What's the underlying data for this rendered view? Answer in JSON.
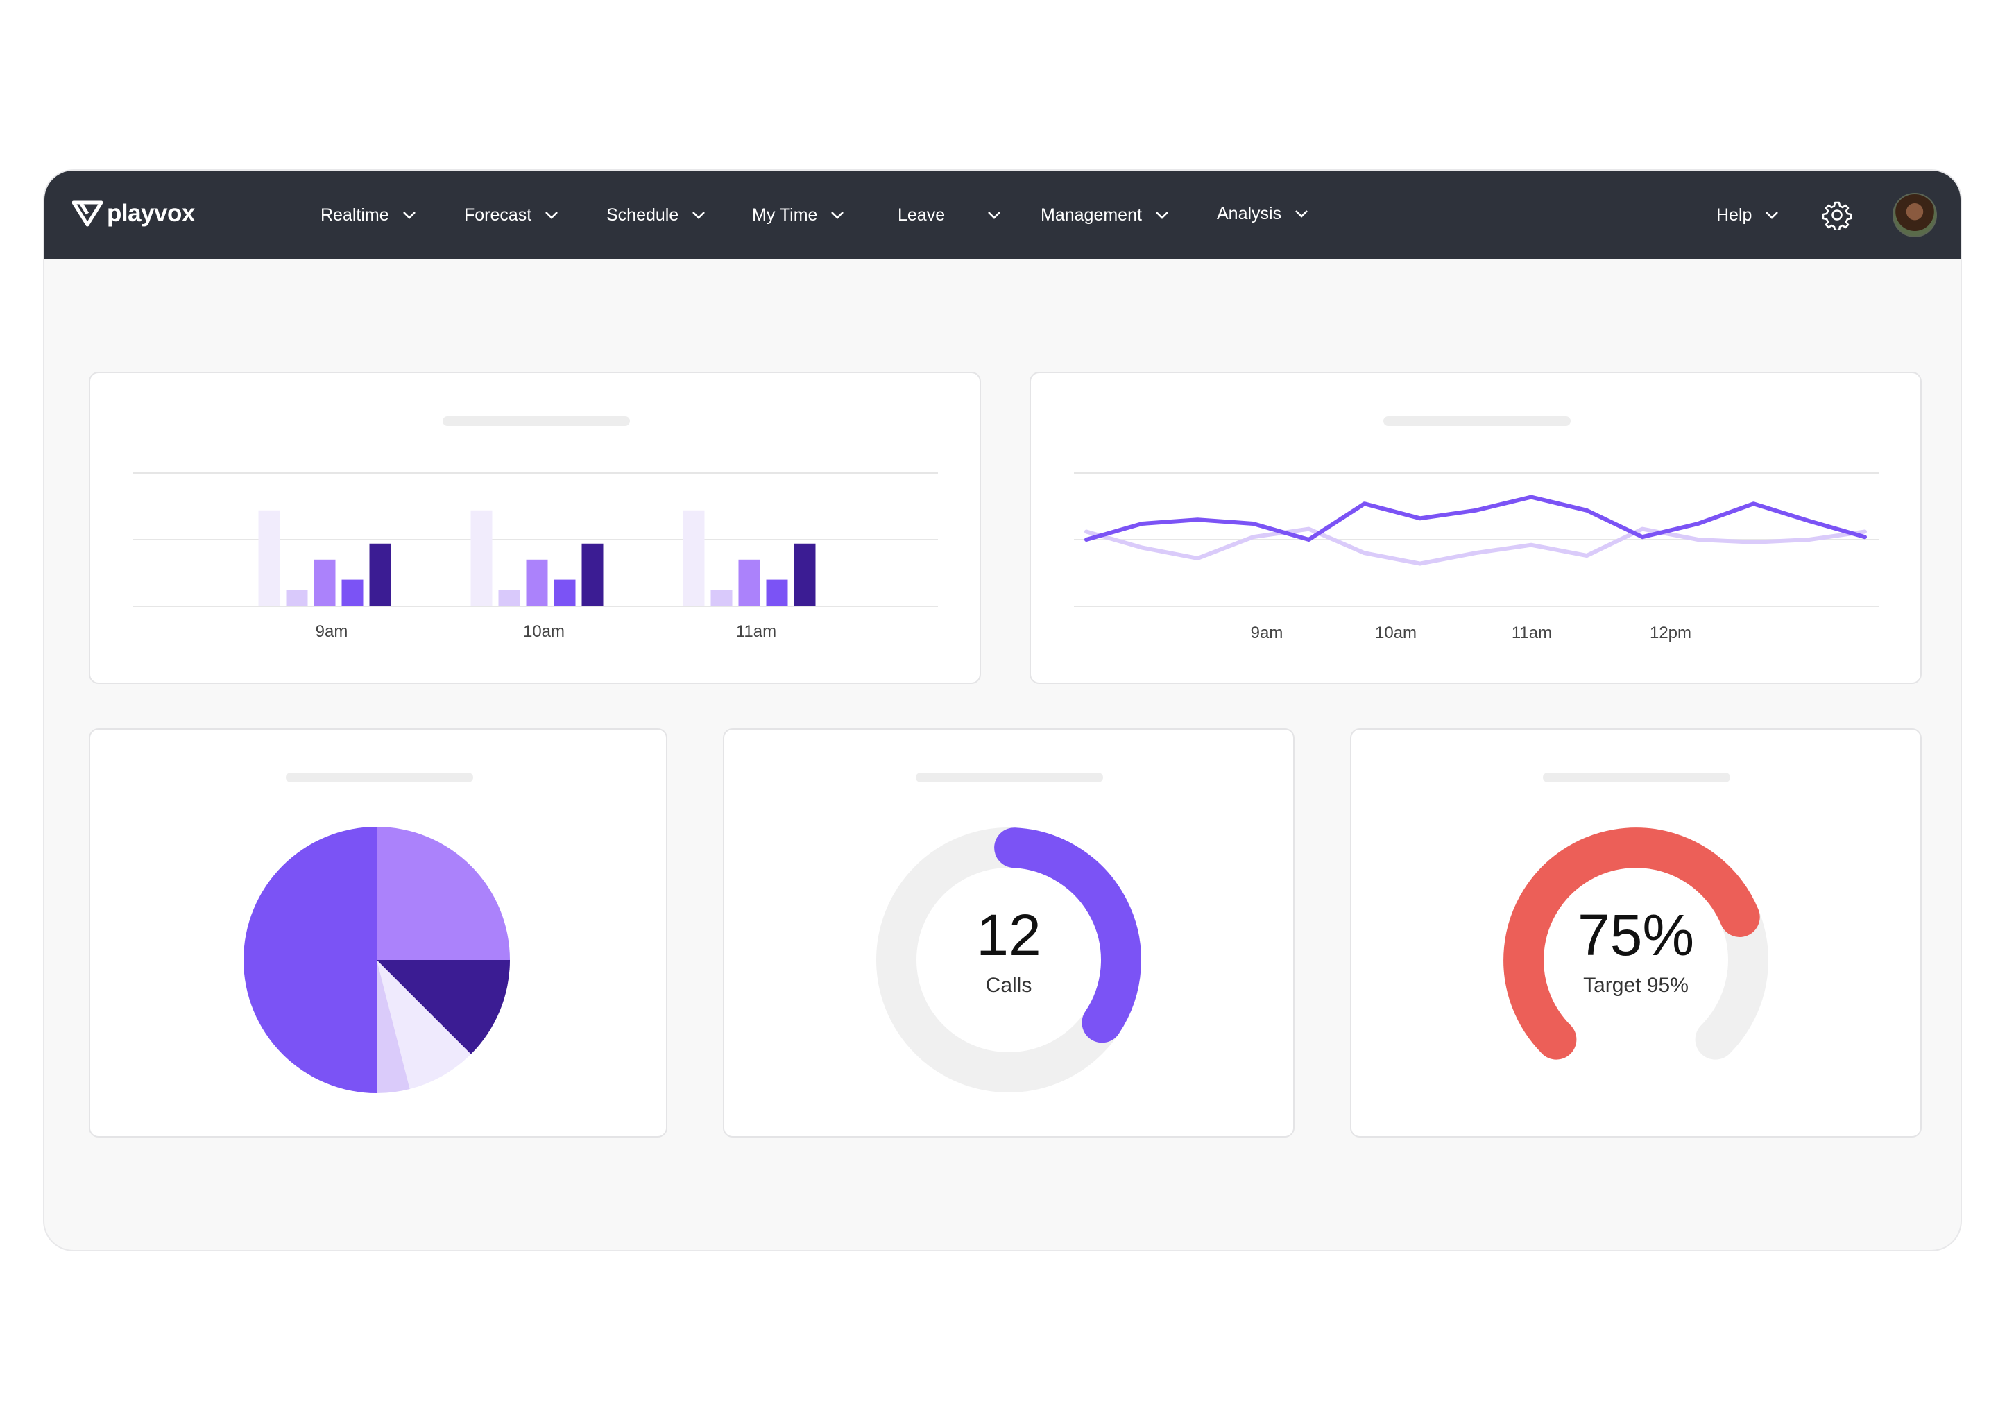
{
  "nav": {
    "brand": "playvox",
    "items": [
      {
        "label": "Realtime"
      },
      {
        "label": "Forecast"
      },
      {
        "label": "Schedule"
      },
      {
        "label": "My Time"
      },
      {
        "label": "Leave"
      },
      {
        "label": "Management"
      },
      {
        "label": "Analysis"
      }
    ],
    "help": "Help",
    "icons": [
      "playvox-logo-icon",
      "chevron-down-icon",
      "gear-icon",
      "avatar"
    ]
  },
  "calls": {
    "value": "12",
    "label": "Calls"
  },
  "target": {
    "value": "75%",
    "label": "Target 95%"
  },
  "chart_data": [
    {
      "type": "bar",
      "categories": [
        "9am",
        "10am",
        "11am"
      ],
      "series": [
        {
          "values": [
            72,
            72,
            72
          ],
          "color": "#f1ecfc"
        },
        {
          "values": [
            12,
            12,
            12
          ],
          "color": "#d9c9fb"
        },
        {
          "values": [
            35,
            35,
            35
          ],
          "color": "#ab82fb"
        },
        {
          "values": [
            20,
            20,
            20
          ],
          "color": "#7b53f5"
        },
        {
          "values": [
            47,
            47,
            47
          ],
          "color": "#3b1c93"
        }
      ],
      "ylim": [
        0,
        100
      ],
      "grid": true
    },
    {
      "type": "line",
      "categories": [
        "9am",
        "10am",
        "11am",
        "12pm"
      ],
      "x": [
        0,
        1,
        2,
        3,
        4,
        5,
        6,
        7,
        8,
        9,
        10,
        11,
        12,
        13,
        14
      ],
      "series": [
        {
          "values": [
            50,
            62,
            65,
            62,
            50,
            77,
            66,
            72,
            82,
            72,
            52,
            62,
            77,
            64,
            52
          ],
          "color": "#7b53f5"
        },
        {
          "values": [
            56,
            44,
            36,
            52,
            58,
            40,
            32,
            40,
            46,
            38,
            58,
            50,
            48,
            50,
            56
          ],
          "color": "#dacbfa"
        }
      ],
      "ylim": [
        0,
        100
      ],
      "grid": true
    },
    {
      "type": "pie",
      "values": [
        50,
        25,
        12.5,
        8.5,
        4
      ],
      "colors": [
        "#7b53f5",
        "#ab82fb",
        "#3b1c93",
        "#efeafd",
        "#dacbfa"
      ]
    },
    {
      "type": "gauge",
      "value": 0.36,
      "start_angle": 0,
      "color": "#7b53f5",
      "track_color": "#f0f0f0"
    },
    {
      "type": "gauge",
      "value": 0.75,
      "target": 0.95,
      "color": "#ec5f58",
      "track_color": "#f0f0f0"
    }
  ],
  "colors": {
    "nav_bg": "#2e323b",
    "accent": "#7b53f5",
    "alert": "#ec5f58"
  }
}
